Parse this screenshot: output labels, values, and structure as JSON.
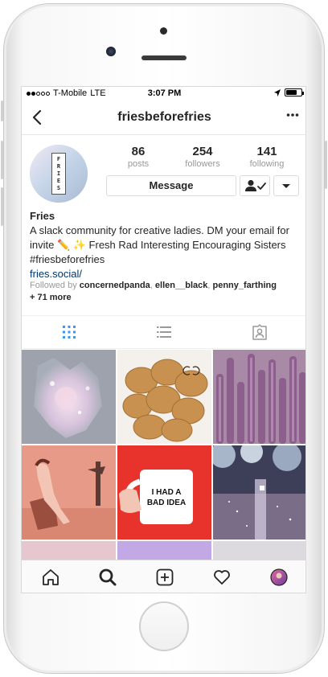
{
  "status_bar": {
    "carrier": "T-Mobile",
    "network": "LTE",
    "time": "3:07 PM",
    "battery_level": 0.7,
    "signal_bars": 2
  },
  "nav": {
    "title": "friesbeforefries",
    "back_icon": "chevron-left-icon",
    "more_icon": "more-options-icon"
  },
  "profile": {
    "avatar_text": "FRIES",
    "stats": [
      {
        "value": "86",
        "label": "posts"
      },
      {
        "value": "254",
        "label": "followers"
      },
      {
        "value": "141",
        "label": "following"
      }
    ],
    "message_button": "Message",
    "name": "Fries",
    "bio": "A slack community for creative ladies. DM your email for invite ✏️ ✨ Fresh Rad Interesting Encouraging Sisters #friesbeforefries",
    "link": "fries.social/",
    "followed_by_prefix": "Followed by",
    "followed_by_users": [
      "concernedpanda",
      "ellen__black",
      "penny_farthing"
    ],
    "followed_by_more": "+ 71 more"
  },
  "view_tabs": [
    {
      "name": "grid-view",
      "active": true
    },
    {
      "name": "list-view",
      "active": false
    },
    {
      "name": "tagged-view",
      "active": false
    }
  ],
  "tabbar": [
    "home-icon",
    "search-icon",
    "add-post-icon",
    "activity-heart-icon",
    "profile-avatar"
  ],
  "colors": {
    "accent": "#3897f0",
    "link": "#003569",
    "text": "#262626",
    "muted": "#999999"
  },
  "posts": [
    {
      "caption": ""
    },
    {
      "caption": ""
    },
    {
      "caption": ""
    },
    {
      "caption": ""
    },
    {
      "caption": "I HAD A BAD IDEA"
    },
    {
      "caption": ""
    }
  ]
}
